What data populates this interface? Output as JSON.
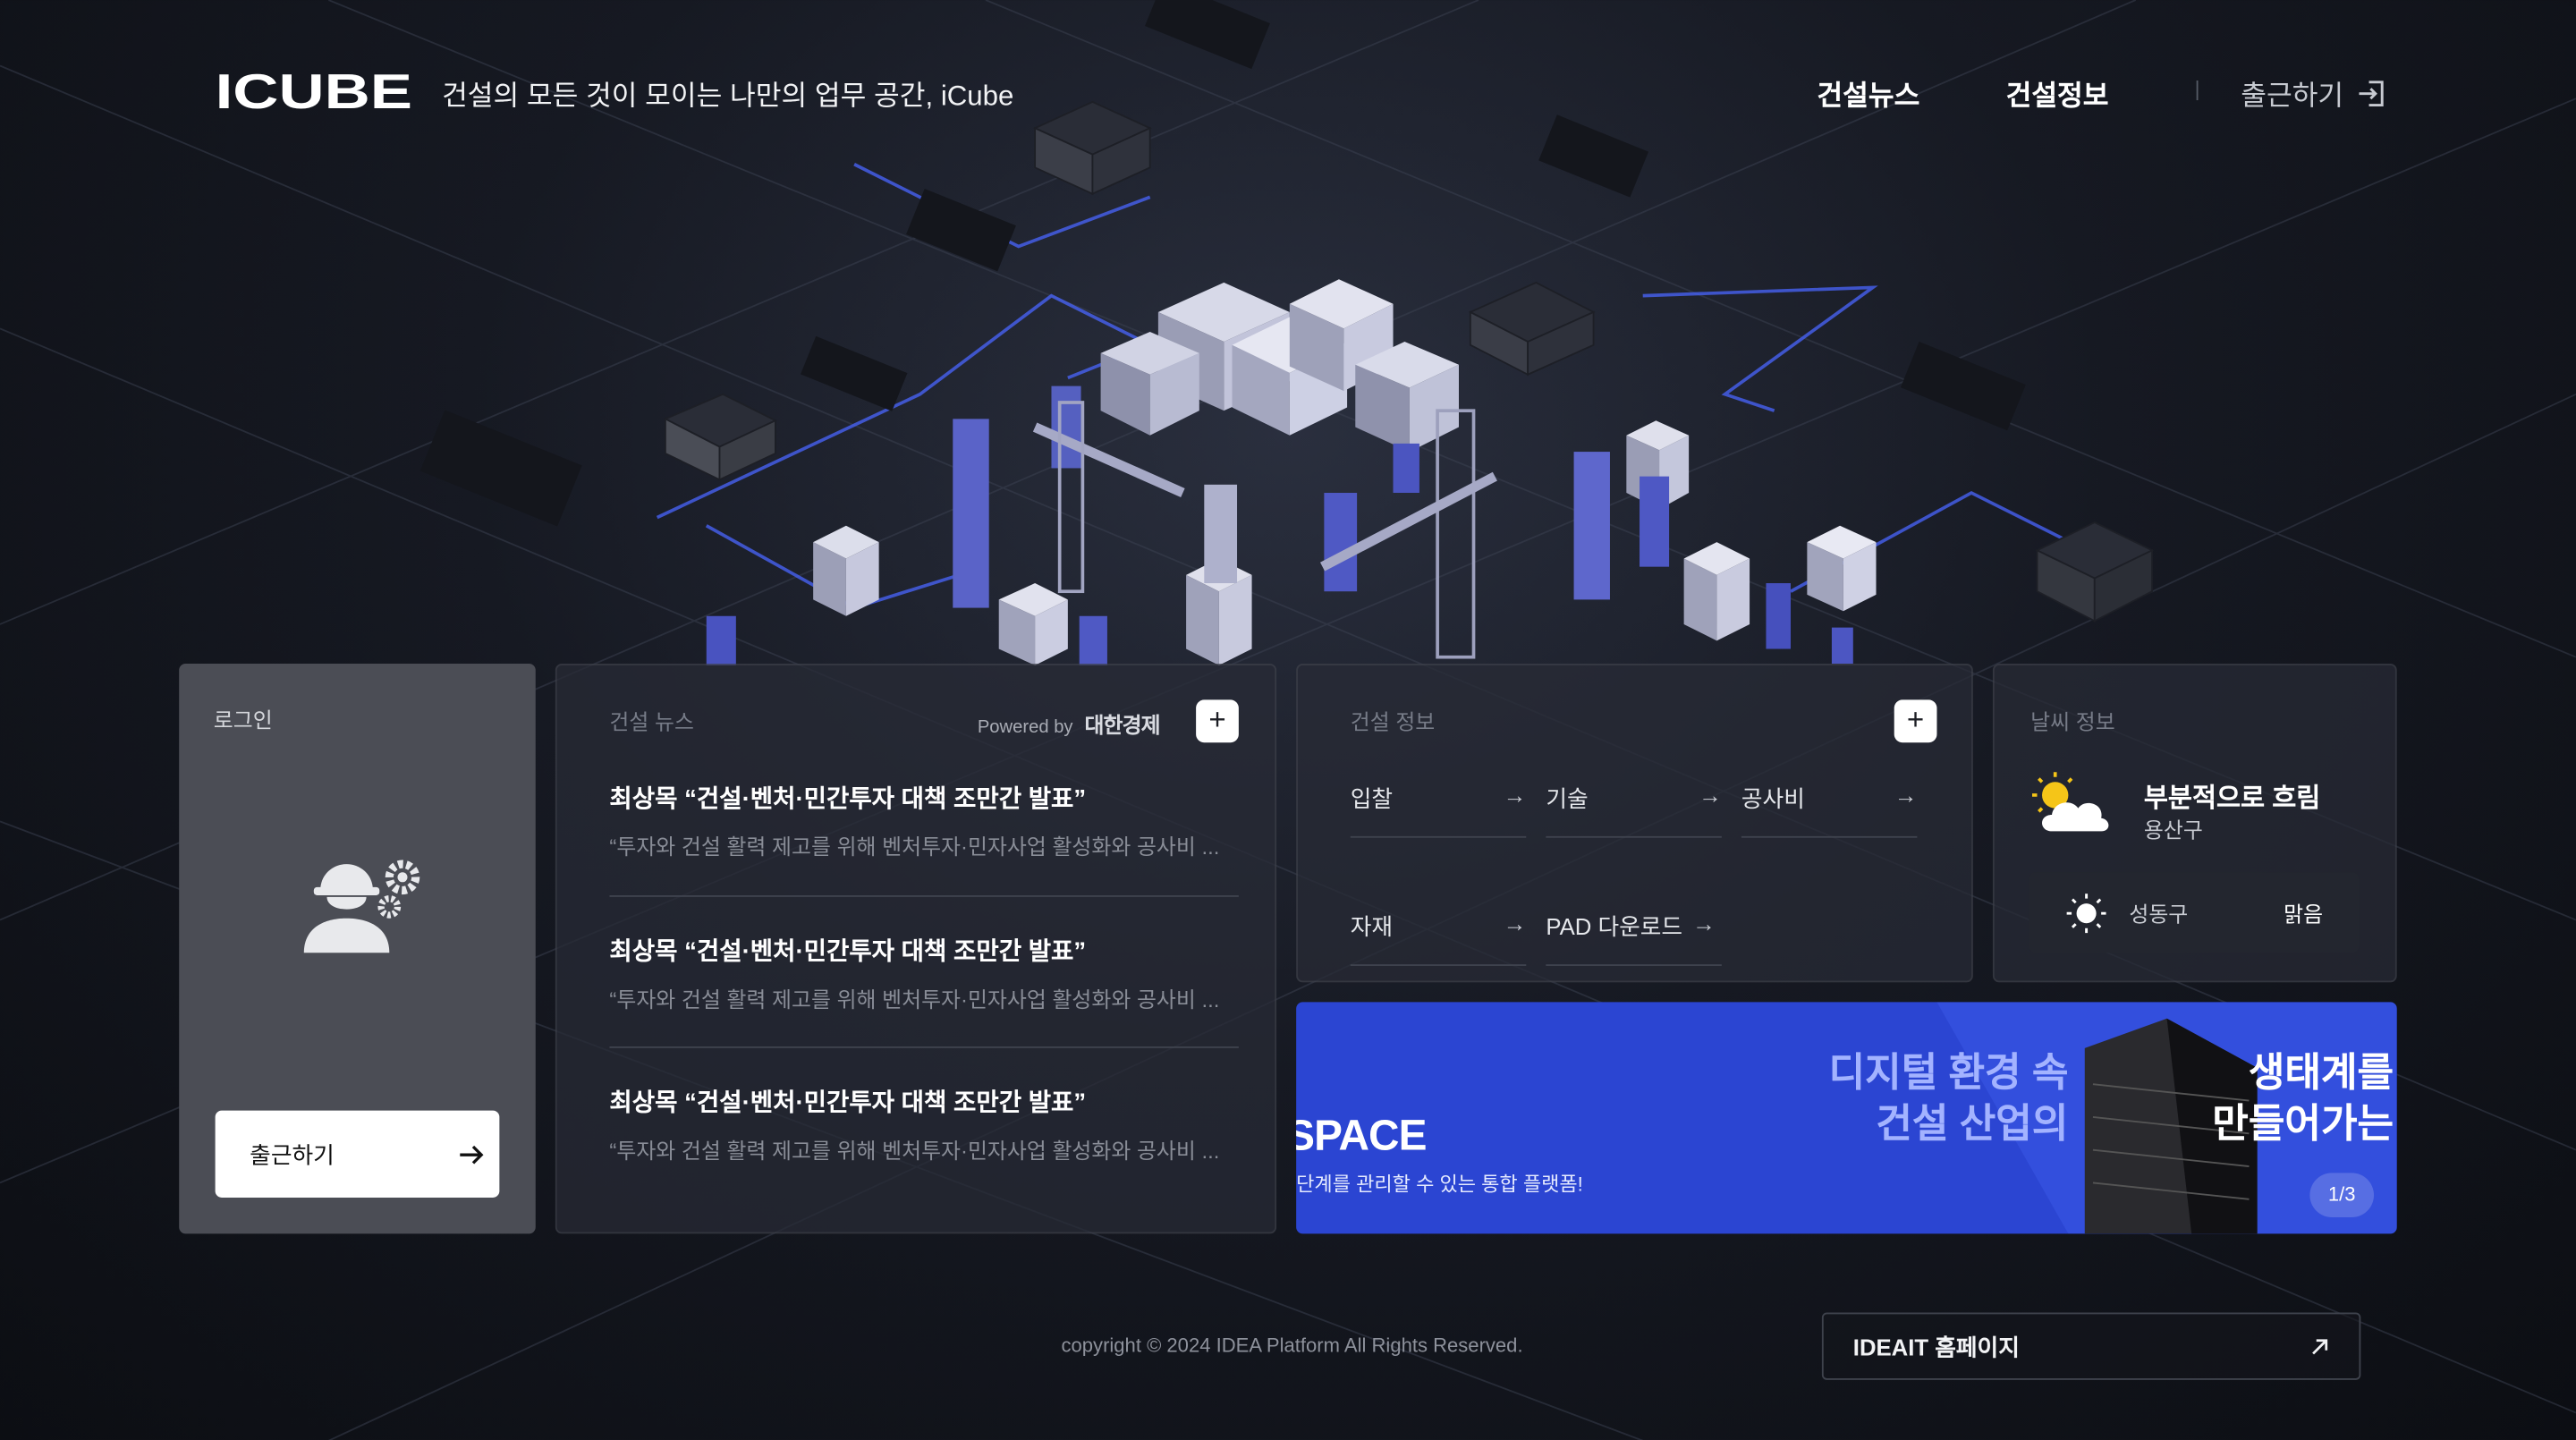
{
  "header": {
    "logo_text": "ICUBE",
    "tagline": "건설의 모든 것이 모이는 나만의 업무 공간, iCube",
    "nav": [
      {
        "label": "건설뉴스"
      },
      {
        "label": "건설정보"
      }
    ],
    "checkin_label": "출근하기"
  },
  "login": {
    "title": "로그인",
    "button_label": "출근하기"
  },
  "news": {
    "title": "건설 뉴스",
    "powered_by": "Powered by",
    "publisher": "대한경제",
    "items": [
      {
        "title": "최상목 “건설·벤처·민간투자 대책 조만간 발표”",
        "snippet": "“투자와 건설 활력 제고를 위해 벤처투자·민자사업 활성화와 공사비 ..."
      },
      {
        "title": "최상목 “건설·벤처·민간투자 대책 조만간 발표”",
        "snippet": "“투자와 건설 활력 제고를 위해 벤처투자·민자사업 활성화와 공사비 ..."
      },
      {
        "title": "최상목 “건설·벤처·민간투자 대책 조만간 발표”",
        "snippet": "“투자와 건설 활력 제고를 위해 벤처투자·민자사업 활성화와 공사비 ..."
      }
    ]
  },
  "info": {
    "title": "건설 정보",
    "links": [
      {
        "label": "입찰"
      },
      {
        "label": "기술"
      },
      {
        "label": "공사비"
      },
      {
        "label": "자재"
      },
      {
        "label": "PAD 다운로드"
      }
    ]
  },
  "weather": {
    "title": "날씨 정보",
    "condition": "부분적으로 흐림",
    "location": "용산구",
    "secondary": {
      "location": "성동구",
      "condition": "맑음"
    }
  },
  "banner": {
    "space_text": "SPACE",
    "subtitle": "단계를 관리할 수 있는 통합 플랫폼!",
    "headline_left": [
      "디지털 환경 속",
      "건설 산업의"
    ],
    "headline_right": [
      "생태계를",
      "만들어가는"
    ],
    "pager": "1/3"
  },
  "footer": {
    "copyright": "copyright © 2024 IDEA Platform All Rights Reserved.",
    "homepage_label": "IDEAIT 홈페이지"
  },
  "colors": {
    "background": "#161922",
    "card": "#282b36",
    "login_card": "#4b4d55",
    "banner": "#2b45d2",
    "accent_blue": "#4a64ff"
  }
}
